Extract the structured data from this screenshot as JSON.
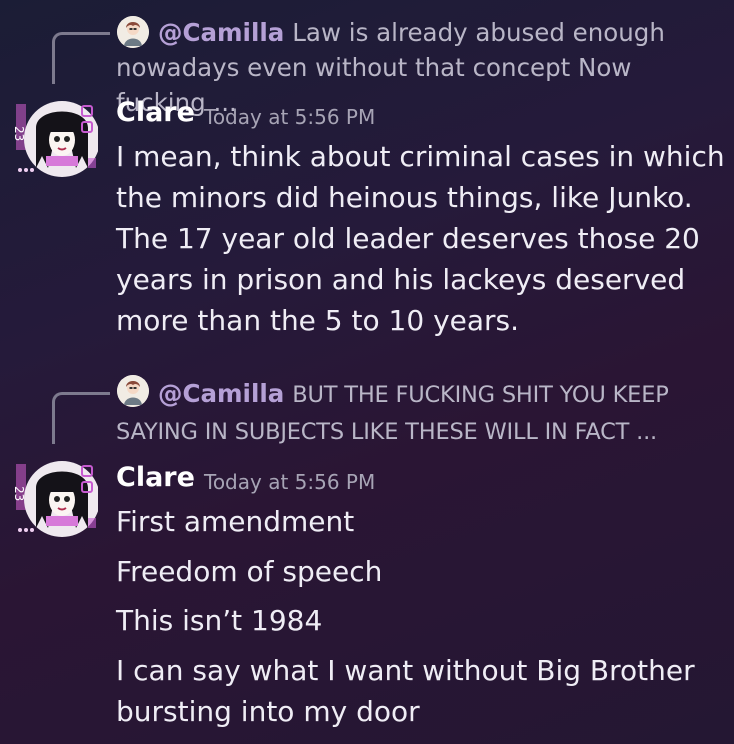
{
  "messages": [
    {
      "reply": {
        "mention": "@Camilla",
        "text": "Law is already abused enough nowadays even without that concept Now fucking ..."
      },
      "author": "Clare",
      "timestamp": "Today at 5:56 PM",
      "body": "I mean, think about criminal cases in which the minors did heinous things, like Junko.  The 17 year old leader deserves those 20 years in prison and his lackeys deserved more than the 5 to 10 years."
    },
    {
      "reply": {
        "mention": "@Camilla",
        "text": "BUT THE FUCKING SHIT YOU KEEP SAYING IN SUBJECTS LIKE THESE WILL IN FACT ..."
      },
      "author": "Clare",
      "timestamp": "Today at 5:56 PM",
      "lines": [
        "First amendment",
        "Freedom of speech",
        "This isn’t 1984",
        "I can say what I want without Big Brother",
        "bursting into my door"
      ]
    }
  ],
  "colors": {
    "mention": "#b5a0d6",
    "author": "#ffffff",
    "timestamp": "#a7a4b5",
    "body_text": "#efedf5",
    "reply_text": "#b9b6c7"
  },
  "icons": {
    "reply_avatar": "reply-author-avatar-icon",
    "author_avatar": "author-avatar-icon"
  }
}
